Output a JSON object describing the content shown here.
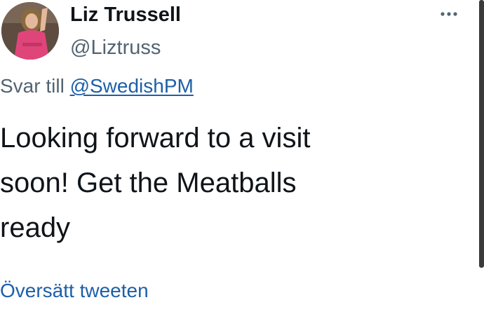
{
  "author": {
    "display_name": "Liz Trussell",
    "handle": "@Liztruss"
  },
  "reply": {
    "prefix": "Svar till",
    "mention": "@SwedishPM"
  },
  "tweet": {
    "text_line1": "Looking forward to a visit",
    "text_line2": "soon! Get the Meatballs",
    "text_line3": "ready"
  },
  "translate_label": "Översätt tweeten",
  "icons": {
    "avatar": "profile-photo",
    "more": "more-options-icon"
  },
  "colors": {
    "link": "#1d5fa8",
    "secondary_text": "#536471",
    "primary_text": "#0f1419"
  }
}
